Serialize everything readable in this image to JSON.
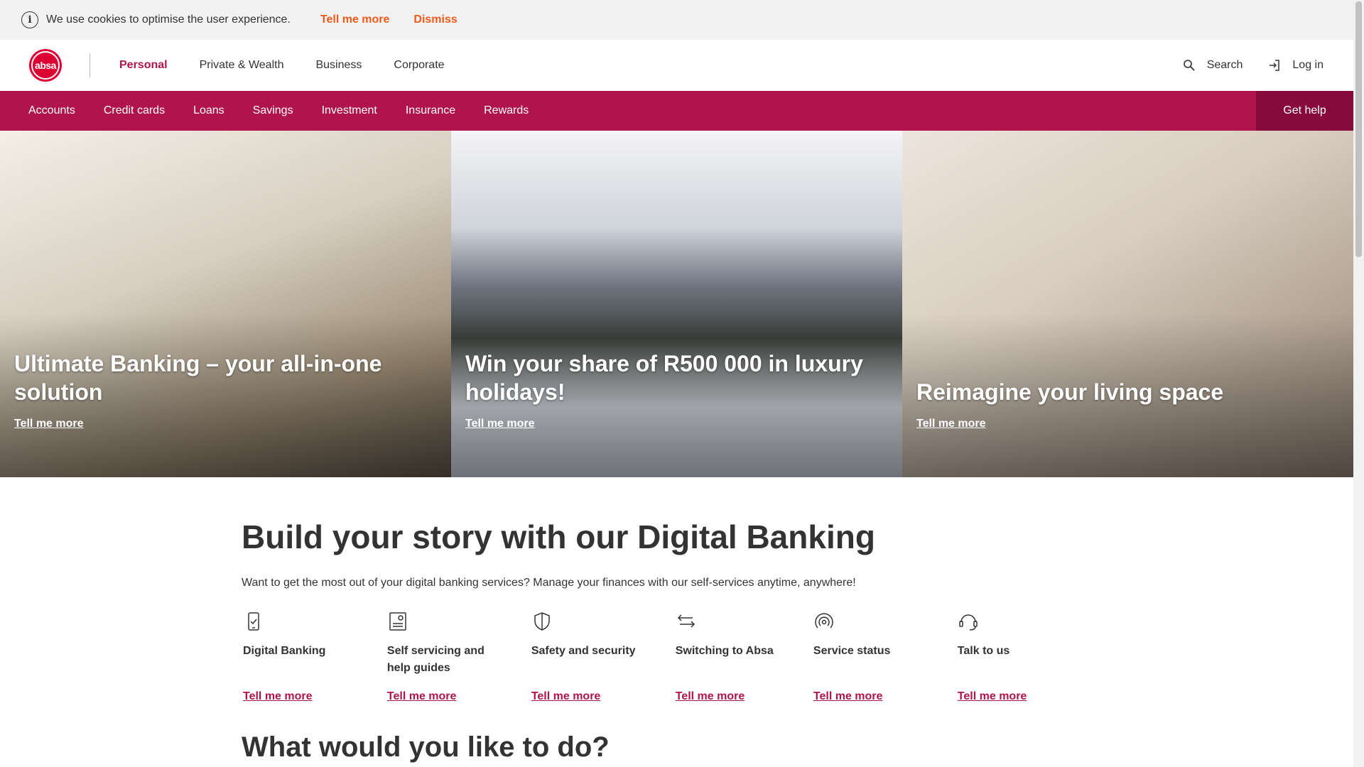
{
  "cookie": {
    "message": "We use cookies to optimise the user experience.",
    "tell_more": "Tell me more",
    "dismiss": "Dismiss"
  },
  "header": {
    "logo_text": "absa",
    "nav": [
      "Personal",
      "Private & Wealth",
      "Business",
      "Corporate"
    ],
    "search": "Search",
    "login": "Log in"
  },
  "subnav": {
    "items": [
      "Accounts",
      "Credit cards",
      "Loans",
      "Savings",
      "Investment",
      "Insurance",
      "Rewards"
    ],
    "get_help": "Get help"
  },
  "hero": [
    {
      "title": "Ultimate Banking – your all-in-one solution",
      "link": "Tell me more"
    },
    {
      "title": "Win your share of R500 000 in luxury holidays!",
      "link": "Tell me more"
    },
    {
      "title": "Reimagine your living space",
      "link": "Tell me more"
    }
  ],
  "content": {
    "heading": "Build your story with our Digital Banking",
    "lead": "Want to get the most out of your digital banking services? Manage your finances with our self-services anytime, anywhere!",
    "features": [
      {
        "title": "Digital Banking",
        "link": "Tell me more",
        "icon": "phone-check-icon"
      },
      {
        "title": "Self servicing and help guides",
        "link": "Tell me more",
        "icon": "guide-icon"
      },
      {
        "title": "Safety and security",
        "link": "Tell me more",
        "icon": "shield-icon"
      },
      {
        "title": "Switching to Absa",
        "link": "Tell me more",
        "icon": "switch-arrows-icon"
      },
      {
        "title": "Service status",
        "link": "Tell me more",
        "icon": "signal-icon"
      },
      {
        "title": "Talk to us",
        "link": "Tell me more",
        "icon": "headset-icon"
      }
    ],
    "second_heading": "What would you like to do?"
  },
  "colors": {
    "brand": "#af144b",
    "brand_dark": "#870a3c",
    "logo_red": "#dc0032",
    "cookie_link": "#f05a1a"
  }
}
